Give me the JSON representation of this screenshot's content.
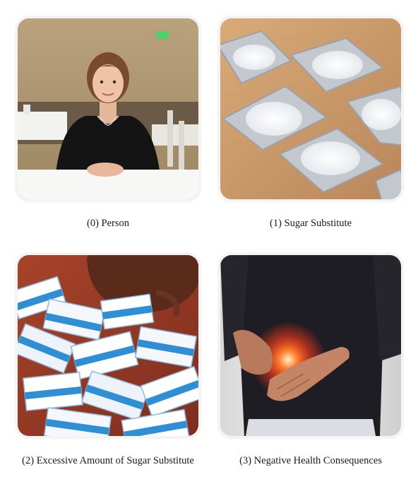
{
  "panels": [
    {
      "caption": "(0) Person",
      "image": "young-woman-seated-at-restaurant-table"
    },
    {
      "caption": "(1) Sugar Substitute",
      "image": "sugar-substitute-packets-on-wood-table"
    },
    {
      "caption": "(2) Excessive Amount of Sugar Substitute",
      "image": "pile-of-sweetener-packets-spilling-from-bowl"
    },
    {
      "caption": "(3) Negative Health Consequences",
      "image": "person-clutching-glowing-painful-stomach"
    }
  ],
  "colors": {
    "background": "#ffffff",
    "caption_text": "#1a1a1a",
    "packet_blue": "#2f8fd4",
    "pain_glow": "#ff3b1a"
  }
}
